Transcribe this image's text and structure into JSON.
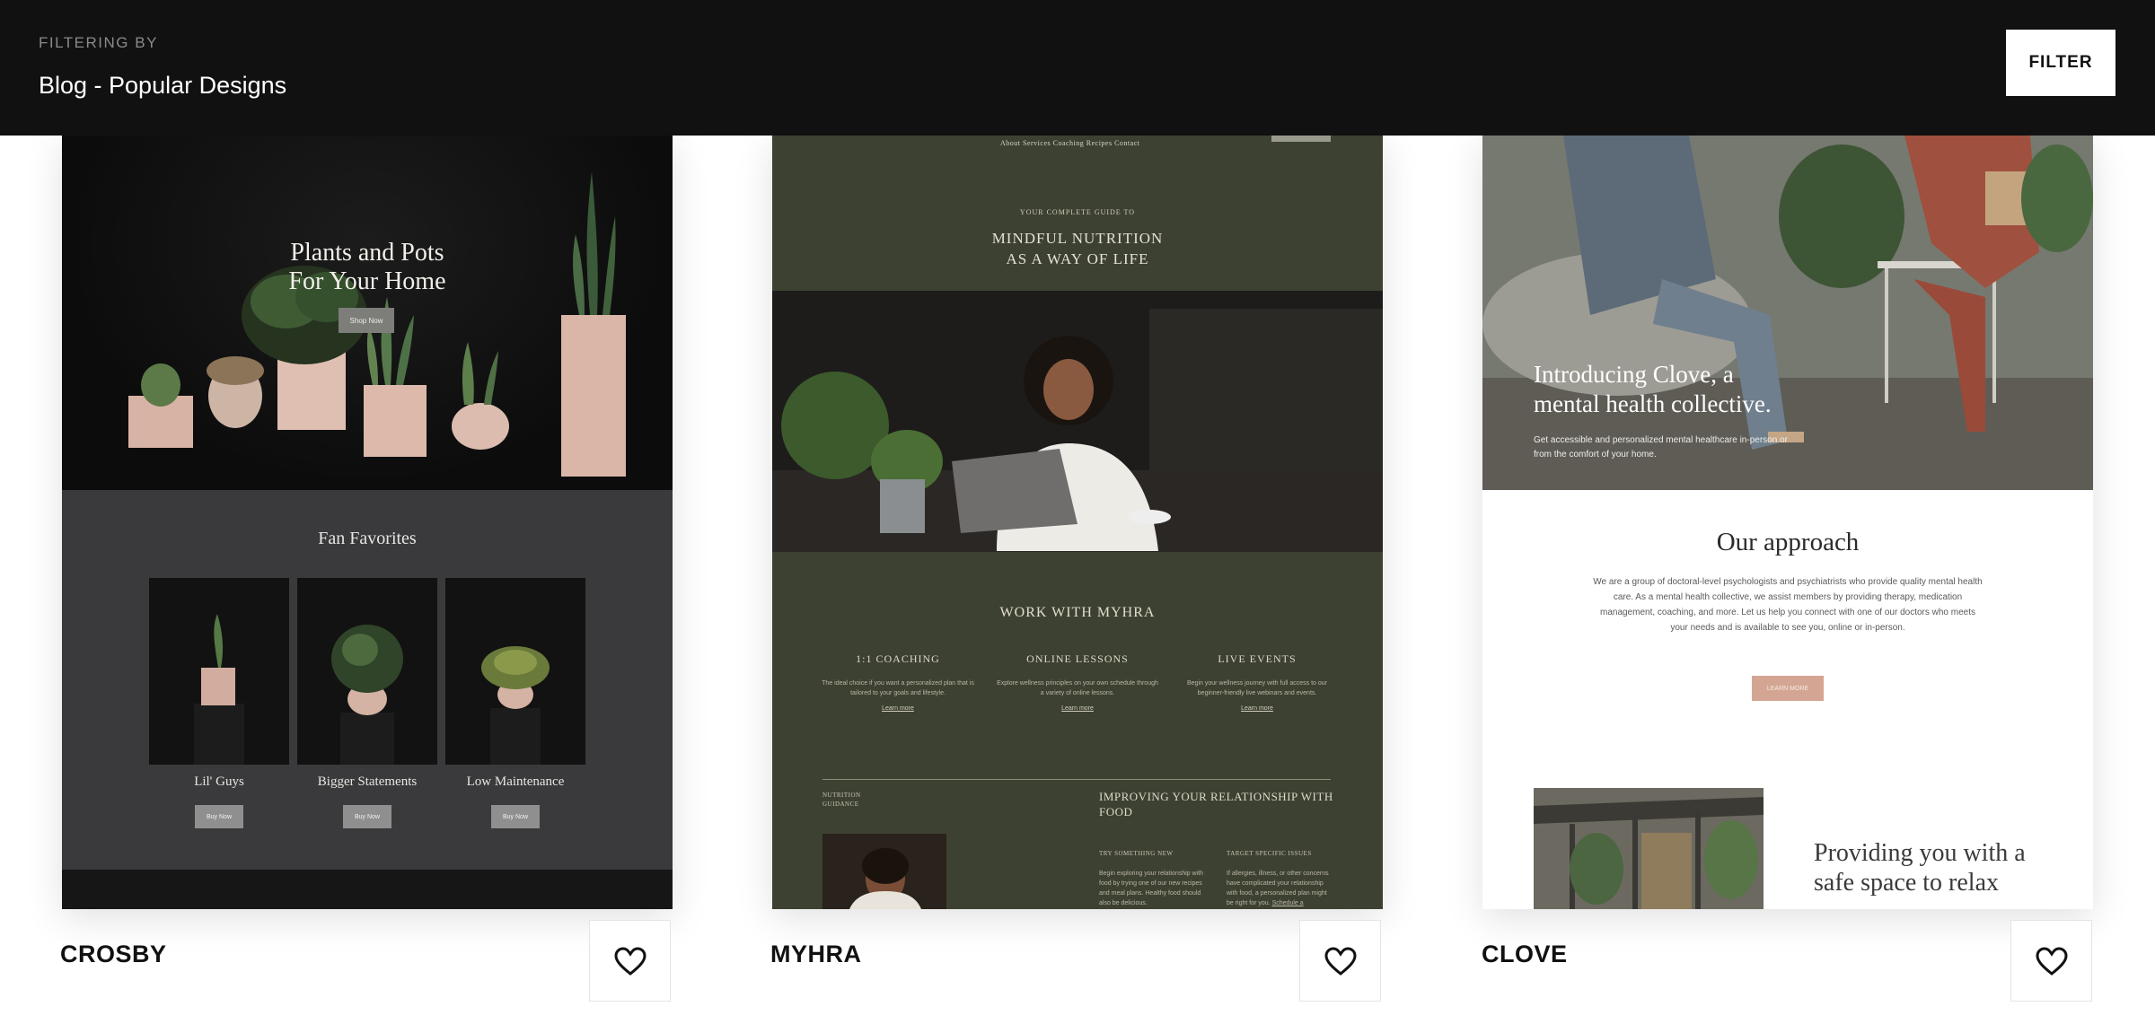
{
  "header": {
    "caption": "FILTERING BY",
    "title": "Blog - Popular Designs",
    "filter_button": "FILTER"
  },
  "templates": [
    {
      "name": "CROSBY",
      "preview": {
        "hero_title_line1": "Plants and Pots",
        "hero_title_line2": "For Your Home",
        "hero_button": "Shop Now",
        "section_title": "Fan Favorites",
        "products": [
          {
            "label": "Lil' Guys",
            "button": "Buy Now"
          },
          {
            "label": "Bigger Statements",
            "button": "Buy Now"
          },
          {
            "label": "Low Maintenance",
            "button": "Buy Now"
          }
        ]
      }
    },
    {
      "name": "MYHRA",
      "preview": {
        "nav": "About    Services    Coaching    Recipes    Contact",
        "guide": "YOUR COMPLETE GUIDE TO",
        "headline_line1": "MINDFUL NUTRITION",
        "headline_line2": "AS A WAY OF LIFE",
        "work_title": "WORK WITH MYHRA",
        "columns": [
          {
            "title": "1:1  COACHING",
            "text": "The ideal choice if you want a personalized plan that is tailored to your goals and lifestyle.",
            "link": "Learn more"
          },
          {
            "title": "ONLINE  LESSONS",
            "text": "Explore wellness principles on your own schedule through a variety of online lessons.",
            "link": "Learn more"
          },
          {
            "title": "LIVE  EVENTS",
            "text": "Begin your wellness journey with full access to our beginner-friendly live webinars and events.",
            "link": "Learn more"
          }
        ],
        "small_label_line1": "NUTRITION",
        "small_label_line2": "GUIDANCE",
        "improving_title": "IMPROVING YOUR RELATIONSHIP WITH FOOD",
        "sub1": "TRY SOMETHING NEW",
        "sub2": "TARGET SPECIFIC ISSUES",
        "para1": "Begin exploring your relationship with food by trying one of our new recipes and meal plans. Healthy food should also be delicious.",
        "para2": "If allergies, illness, or other concerns have complicated your relationship with food, a personalized plan might be right for you.",
        "para2_link": "Schedule a consultation"
      }
    },
    {
      "name": "CLOVE",
      "preview": {
        "hero_title_line1": "Introducing Clove, a",
        "hero_title_line2": "mental health collective.",
        "hero_sub": "Get accessible and personalized mental healthcare in-person or from the comfort of your home.",
        "approach_title": "Our approach",
        "approach_body": "We are a group of doctoral-level psychologists and psychiatrists who provide quality mental health care. As a mental health collective, we assist members by providing therapy, medication management, coaching, and more. Let us help you connect with one of our doctors who meets your needs and is available to see you, online or in-person.",
        "cta": "LEARN MORE",
        "providing_line1": "Providing you with a",
        "providing_line2": "safe space to relax"
      }
    }
  ],
  "colors": {
    "header_bg": "#111111",
    "crosby_bg": "#0c0c0c",
    "crosby_section": "#3a393b",
    "myhra_bg": "#3d4131",
    "clove_accent": "#d4a593"
  },
  "icons": {
    "favorite": "heart-icon"
  }
}
